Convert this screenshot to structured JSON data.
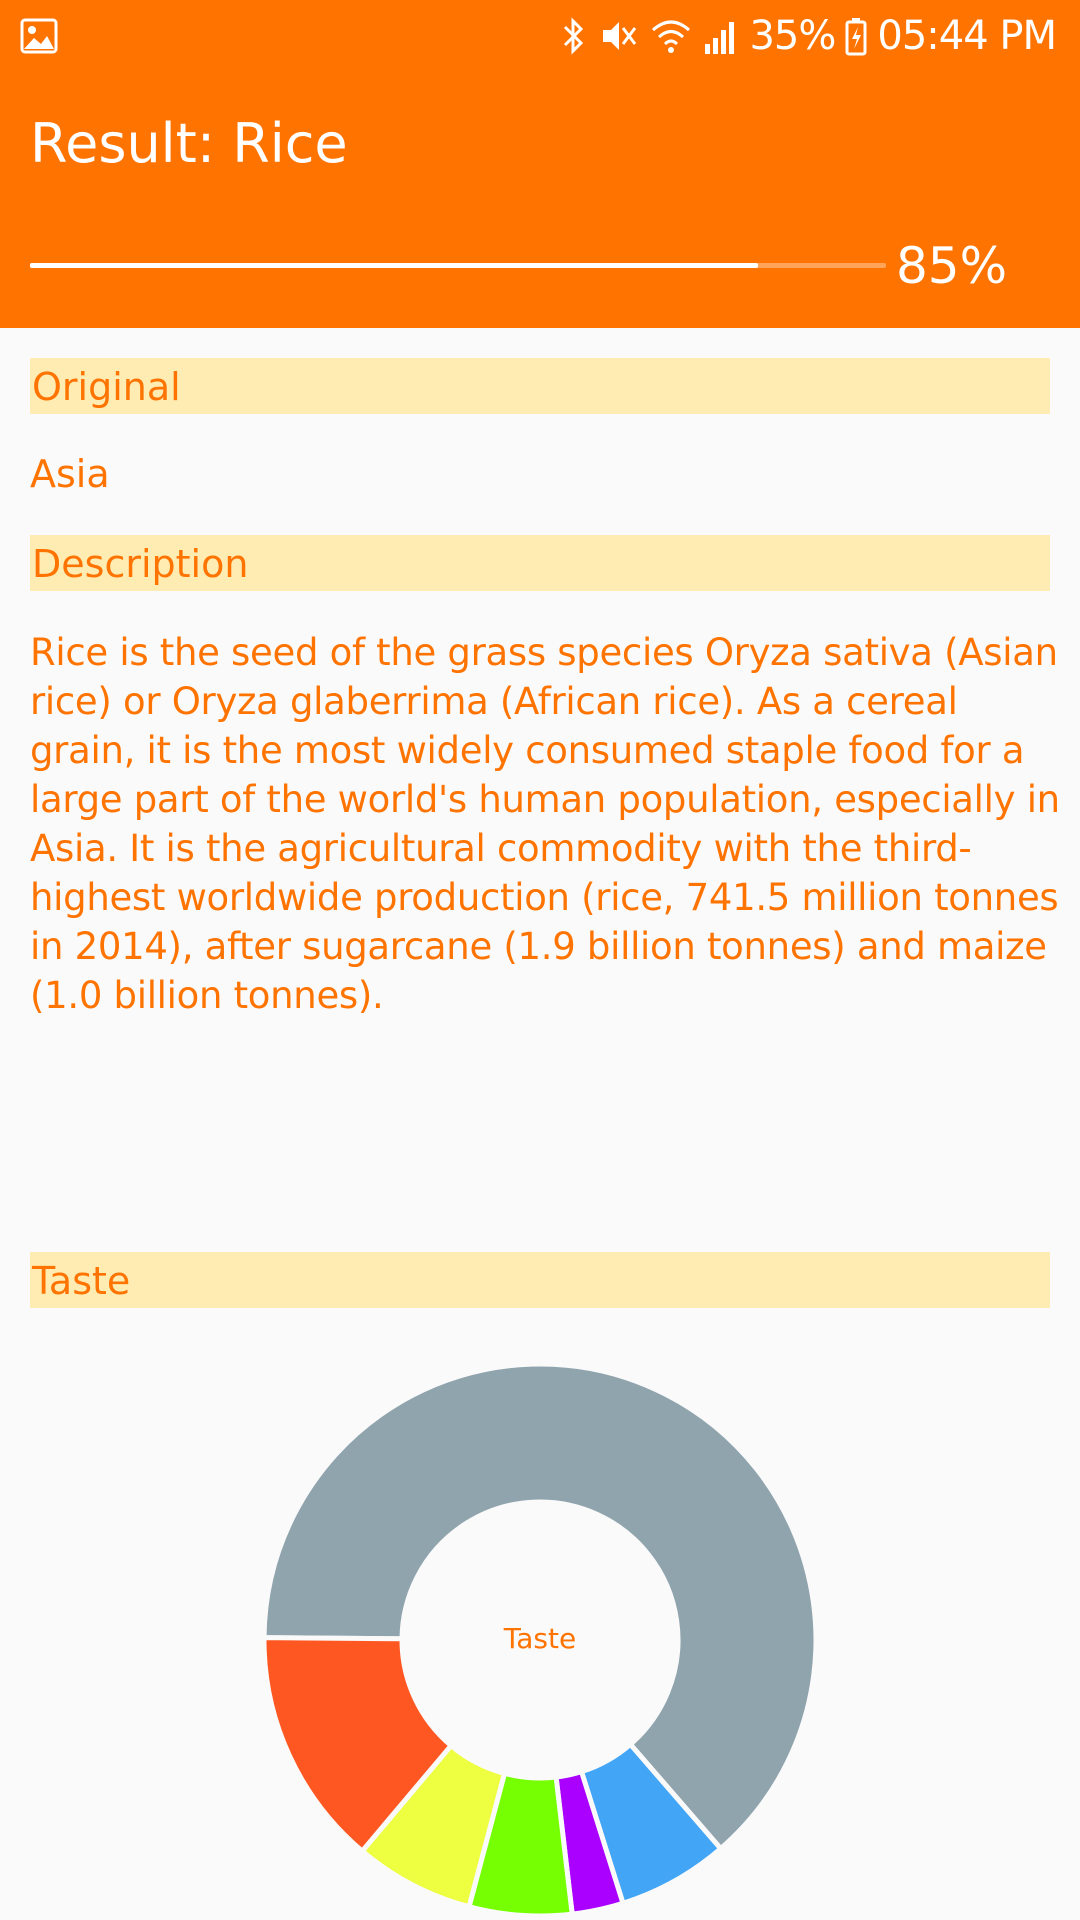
{
  "status_bar": {
    "battery": "35%",
    "time": "05:44 PM",
    "icons": [
      "gallery-icon",
      "bluetooth-icon",
      "mute-icon",
      "wifi-icon",
      "signal-icon",
      "battery-charging-icon"
    ]
  },
  "header": {
    "title": "Result: Rice",
    "confidence_fraction": 0.85,
    "confidence_label": "85%",
    "background_color": "#ff7300"
  },
  "sections": {
    "original": {
      "heading": "Original",
      "value": "Asia"
    },
    "description": {
      "heading": "Description",
      "text": "Rice is the seed of the grass species Oryza sativa (Asian rice) or Oryza glaberrima (African rice). As a cereal grain, it is the most widely consumed staple food for a large part of the world's human population, especially in Asia. It is the agricultural commodity with the third-highest worldwide production (rice, 741.5 million tonnes in 2014), after sugarcane (1.9 billion tonnes) and maize (1.0 billion tonnes)."
    },
    "taste": {
      "heading": "Taste"
    }
  },
  "colors": {
    "accent": "#ff7300",
    "section_background": "#ffecb3",
    "page_background": "#fafafa"
  },
  "chart_data": {
    "type": "pie",
    "center_label": "Taste",
    "start_angle_deg": 180.5,
    "slices": [
      {
        "value": 63.5,
        "color": "#90a4ae"
      },
      {
        "value": 6.5,
        "color": "#42a5f5"
      },
      {
        "value": 3.0,
        "color": "#aa00ff"
      },
      {
        "value": 6.0,
        "color": "#76ff03"
      },
      {
        "value": 7.0,
        "color": "#eeff41"
      },
      {
        "value": 14.0,
        "color": "#ff5722"
      }
    ]
  }
}
